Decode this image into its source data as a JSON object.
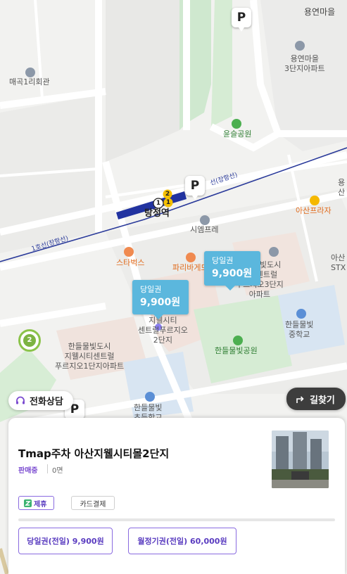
{
  "map": {
    "labels": {
      "yongyeon_village": "용연마을",
      "yongyeon_complex3": "용연마을\n3단지아파트",
      "maegok1ri_hall": "매곡1리회관",
      "yunseul_park": "윤슬공원",
      "line_janghang_top": "선(장항선)",
      "line_janghang_left": "1호선(장항선)",
      "tangjeong_station": "탕정역",
      "asan_plaza": "아산프라자",
      "asan_stx": "아산\nSTX",
      "yongyeon_far_right": "용\n산",
      "cmprj": "시엠프레",
      "starbucks": "스타벅스",
      "paris_baguette": "파리바게뜨",
      "hanbeul_23": "한들물빛도시\n시티센트럴\n푸르지오3단지\n아파트",
      "smart_partial": "시\n지웰시티\n센트럴푸르지오\n2단지",
      "hanbeul_1": "한들물빛도시\n지웰시티센트럴\n푸르지오1단지아파트",
      "hanbeul_park": "한들물빛공원",
      "hanbeul_middle": "한들물빛\n중학교",
      "hanbeul_elementary": "한들물빛\n초등학교"
    },
    "parking_marker_label": "P",
    "price_tags": [
      {
        "type": "당일권",
        "price": "9,900원"
      },
      {
        "type": "당일권",
        "price": "9,900원"
      }
    ],
    "cluster_count": "2",
    "station_badges": [
      "1",
      "2",
      "1"
    ],
    "colors": {
      "price_tag": "#5bb7dd",
      "line": "#2a3a9a",
      "accent": "#5a3cc0"
    }
  },
  "actions": {
    "call_consult": "전화상담",
    "directions": "길찾기"
  },
  "card": {
    "title": "Tmap주차 아산지웰시티몰2단지",
    "status": "판매중",
    "spaces": "0면",
    "chips": {
      "partner": "제휴",
      "card_payment": "카드결제"
    },
    "prices": {
      "daily": "당일권(전일) 9,900원",
      "monthly": "월정기권(전일) 60,000원"
    }
  }
}
